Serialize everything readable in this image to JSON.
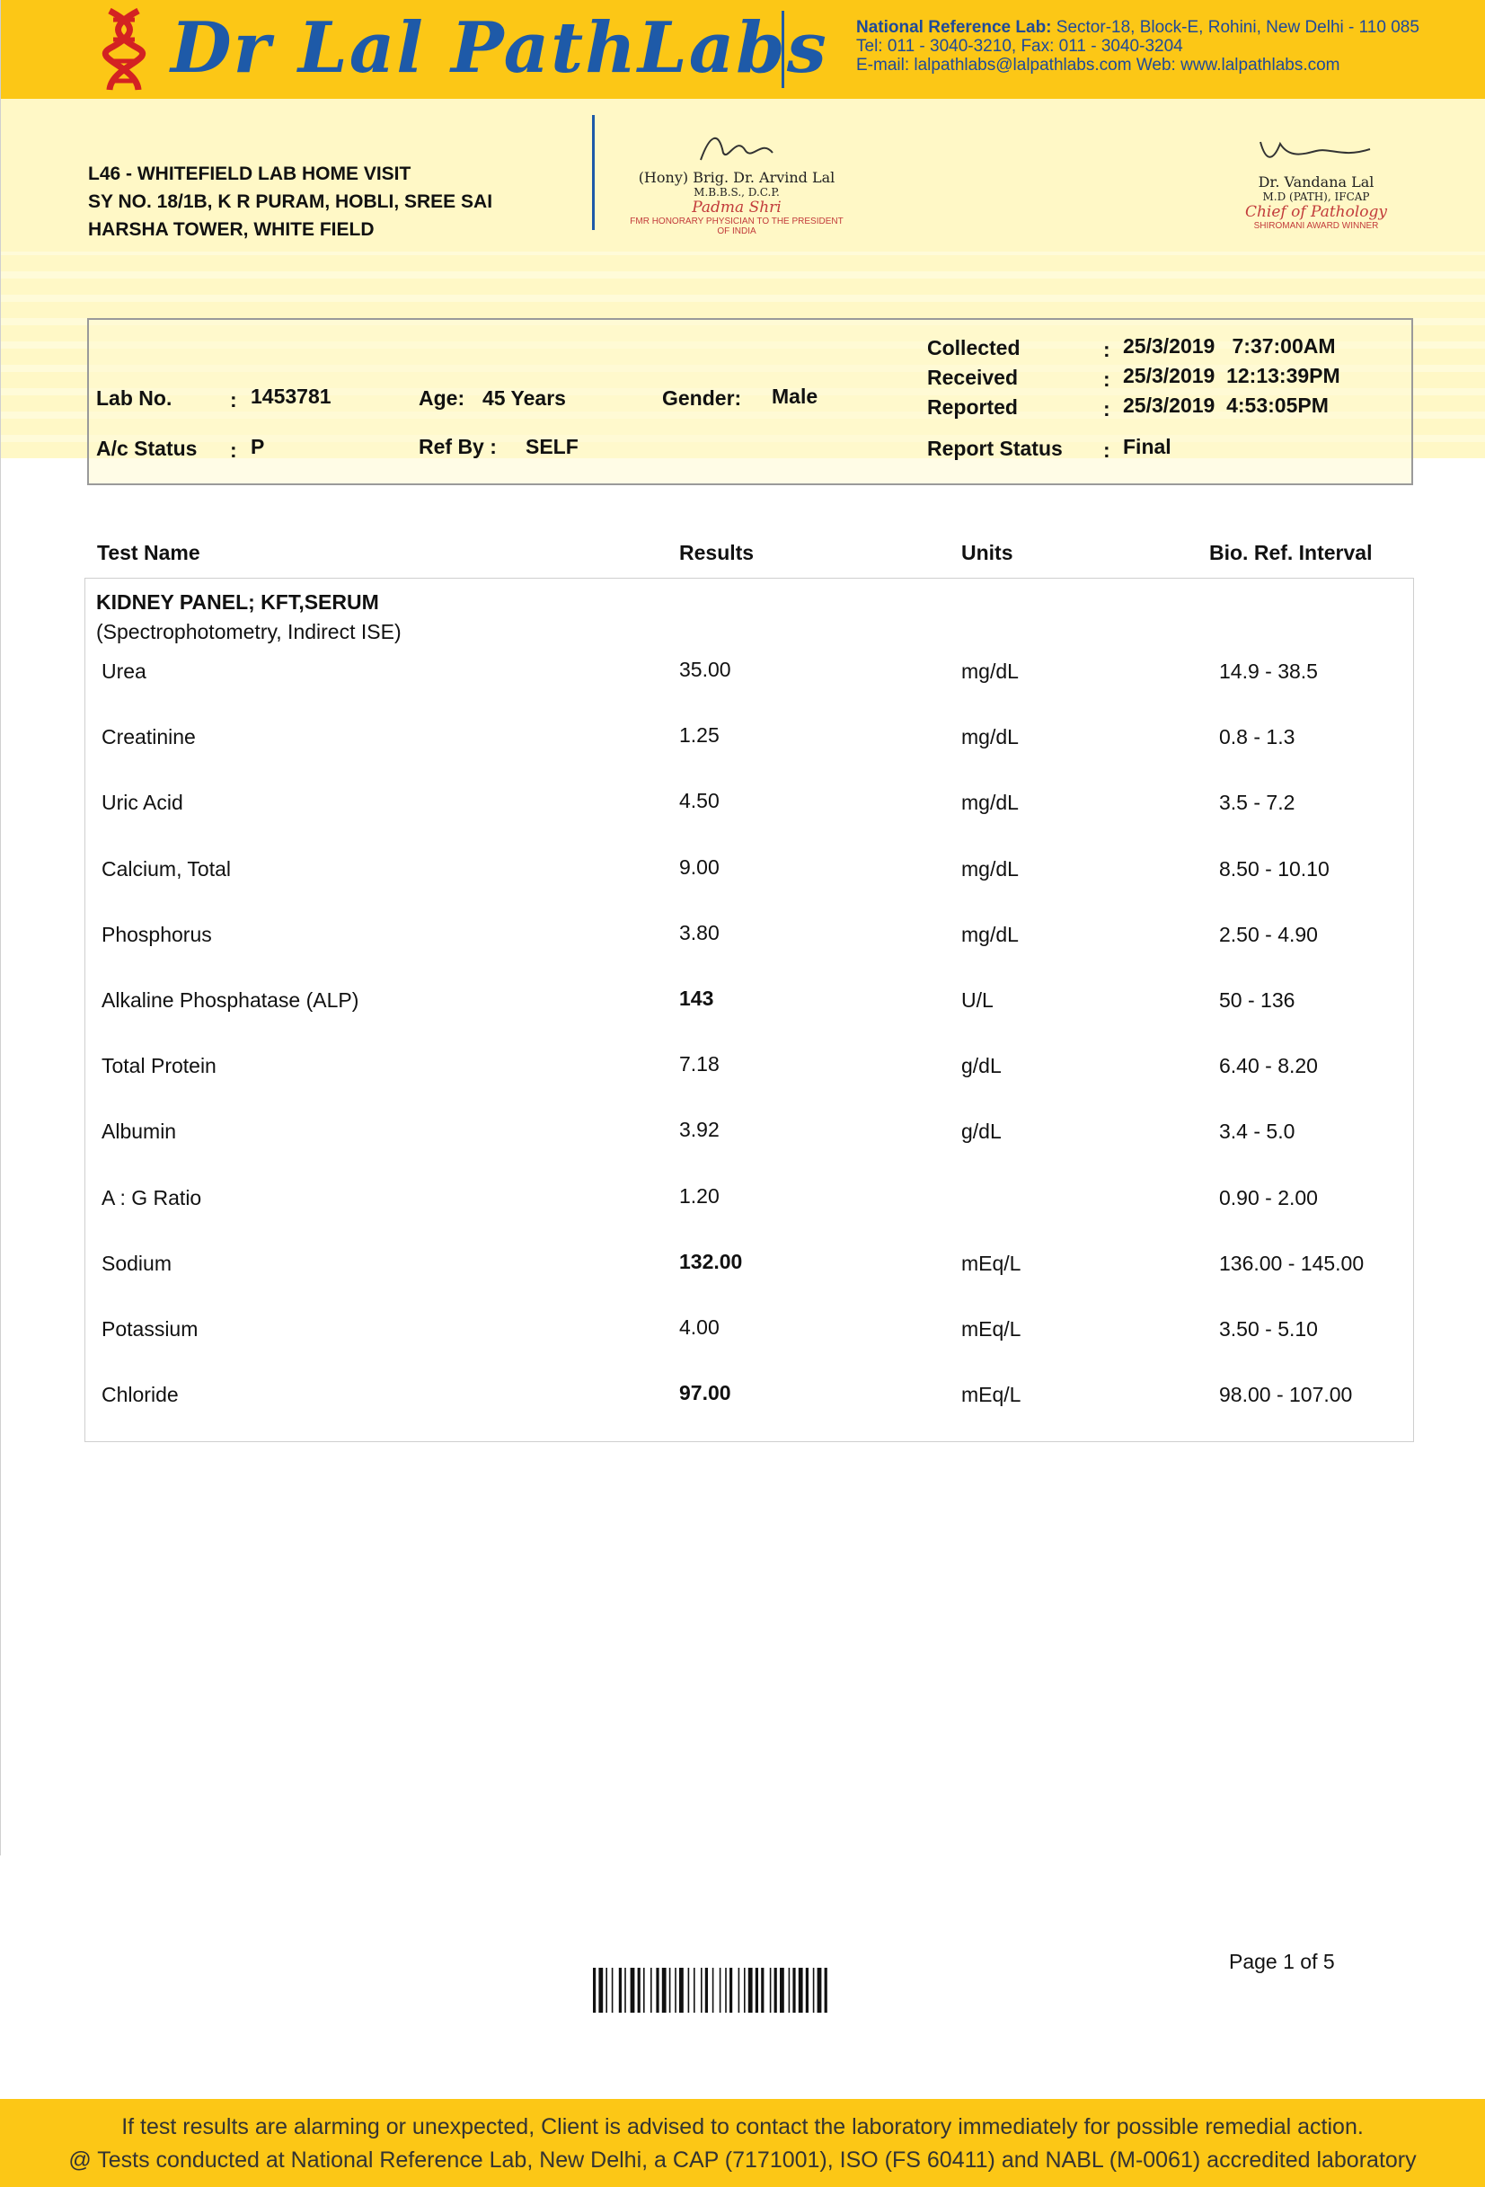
{
  "header": {
    "brand": "Dr Lal PathLabs",
    "ref_lab_label": "National Reference Lab:",
    "ref_lab_address": "Sector-18, Block-E, Rohini, New Delhi - 110 085",
    "tel_line": "Tel: 011 - 3040-3210, Fax: 011 - 3040-3204",
    "email_line": "E-mail: lalpathlabs@lalpathlabs.com Web: www.lalpathlabs.com",
    "brand_color": "#1e5aa8",
    "band_color": "#fcc716"
  },
  "lab": {
    "address_lines": [
      "L46 - WHITEFIELD LAB HOME VISIT",
      "SY NO. 18/1B, K R PURAM, HOBLI, SREE SAI",
      "HARSHA TOWER, WHITE FIELD"
    ]
  },
  "signatories": [
    {
      "name": "(Hony) Brig. Dr. Arvind Lal",
      "degree": "M.B.B.S., D.C.P.",
      "title": "Padma Shri",
      "note": "FMR HONORARY PHYSICIAN TO THE PRESIDENT OF INDIA"
    },
    {
      "name": "Dr. Vandana Lal",
      "degree": "M.D (PATH), IFCAP",
      "title": "Chief of Pathology",
      "note": "SHIROMANI AWARD WINNER"
    }
  ],
  "patient": {
    "lab_no_label": "Lab No.",
    "lab_no": "1453781",
    "age_label": "Age:",
    "age": "45 Years",
    "gender_label": "Gender:",
    "gender": "Male",
    "ac_status_label": "A/c Status",
    "ac_status": "P",
    "ref_by_label": "Ref By :",
    "ref_by": "SELF",
    "collected_label": "Collected",
    "collected": "25/3/2019   7:37:00AM",
    "received_label": "Received",
    "received": "25/3/2019  12:13:39PM",
    "reported_label": "Reported",
    "reported": "25/3/2019  4:53:05PM",
    "report_status_label": "Report Status",
    "report_status": "Final",
    "colon": ":"
  },
  "table": {
    "headers": [
      "Test Name",
      "Results",
      "Units",
      "Bio. Ref. Interval"
    ],
    "panel_title": "KIDNEY PANEL; KFT,SERUM",
    "panel_method": "(Spectrophotometry, Indirect ISE)",
    "rows": [
      {
        "test": "Urea",
        "result": "35.00",
        "units": "mg/dL",
        "ref": "14.9 - 38.5",
        "flag": false
      },
      {
        "test": "Creatinine",
        "result": "1.25",
        "units": "mg/dL",
        "ref": "0.8 - 1.3",
        "flag": false
      },
      {
        "test": "Uric Acid",
        "result": "4.50",
        "units": "mg/dL",
        "ref": "3.5 - 7.2",
        "flag": false
      },
      {
        "test": "Calcium, Total",
        "result": "9.00",
        "units": "mg/dL",
        "ref": "8.50 - 10.10",
        "flag": false
      },
      {
        "test": "Phosphorus",
        "result": "3.80",
        "units": "mg/dL",
        "ref": "2.50 - 4.90",
        "flag": false
      },
      {
        "test": "Alkaline Phosphatase (ALP)",
        "result": "143",
        "units": "U/L",
        "ref": "50 - 136",
        "flag": true
      },
      {
        "test": "Total Protein",
        "result": "7.18",
        "units": "g/dL",
        "ref": "6.40 - 8.20",
        "flag": false
      },
      {
        "test": "Albumin",
        "result": "3.92",
        "units": "g/dL",
        "ref": "3.4 - 5.0",
        "flag": false
      },
      {
        "test": "A : G Ratio",
        "result": "1.20",
        "units": "",
        "ref": "0.90 - 2.00",
        "flag": false
      },
      {
        "test": "Sodium",
        "result": "132.00",
        "units": "mEq/L",
        "ref": "136.00 - 145.00",
        "flag": true
      },
      {
        "test": "Potassium",
        "result": "4.00",
        "units": "mEq/L",
        "ref": "3.50 - 5.10",
        "flag": false
      },
      {
        "test": "Chloride",
        "result": "97.00",
        "units": "mEq/L",
        "ref": "98.00 - 107.00",
        "flag": true
      }
    ]
  },
  "page": {
    "page_number": "Page 1 of 5"
  },
  "footer": {
    "line1": "If test results are alarming or unexpected, Client is advised to contact the laboratory immediately for possible remedial action.",
    "line2": "@ Tests conducted at National Reference Lab, New Delhi, a CAP (7171001), ISO (FS 60411) and NABL (M-0061) accredited laboratory"
  }
}
